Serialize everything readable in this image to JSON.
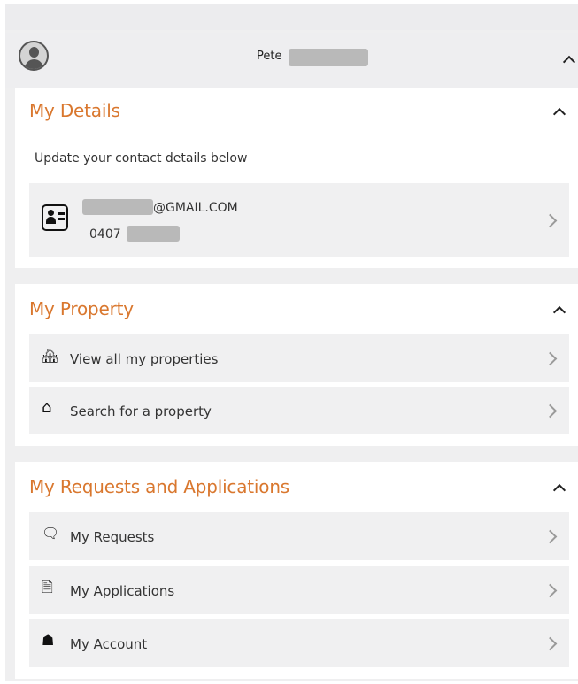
{
  "header": {
    "user_name": "Pete"
  },
  "details": {
    "title": "My Details",
    "subtitle": "Update your contact details below",
    "email": "@GMAIL.COM",
    "phone": "0407"
  },
  "property": {
    "title": "My Property",
    "items": [
      {
        "label": "View all my properties",
        "icon": "houses-icon"
      },
      {
        "label": "Search for a property",
        "icon": "home-icon"
      }
    ]
  },
  "requests": {
    "title": "My Requests and Applications",
    "items": [
      {
        "label": "My Requests",
        "icon": "chat-icon"
      },
      {
        "label": "My Applications",
        "icon": "documents-icon"
      },
      {
        "label": "My Account",
        "icon": "account-icon"
      }
    ]
  },
  "colors": {
    "accent": "#d9772e",
    "row_background": "#f0f0f1",
    "page_background": "#efeff0"
  }
}
